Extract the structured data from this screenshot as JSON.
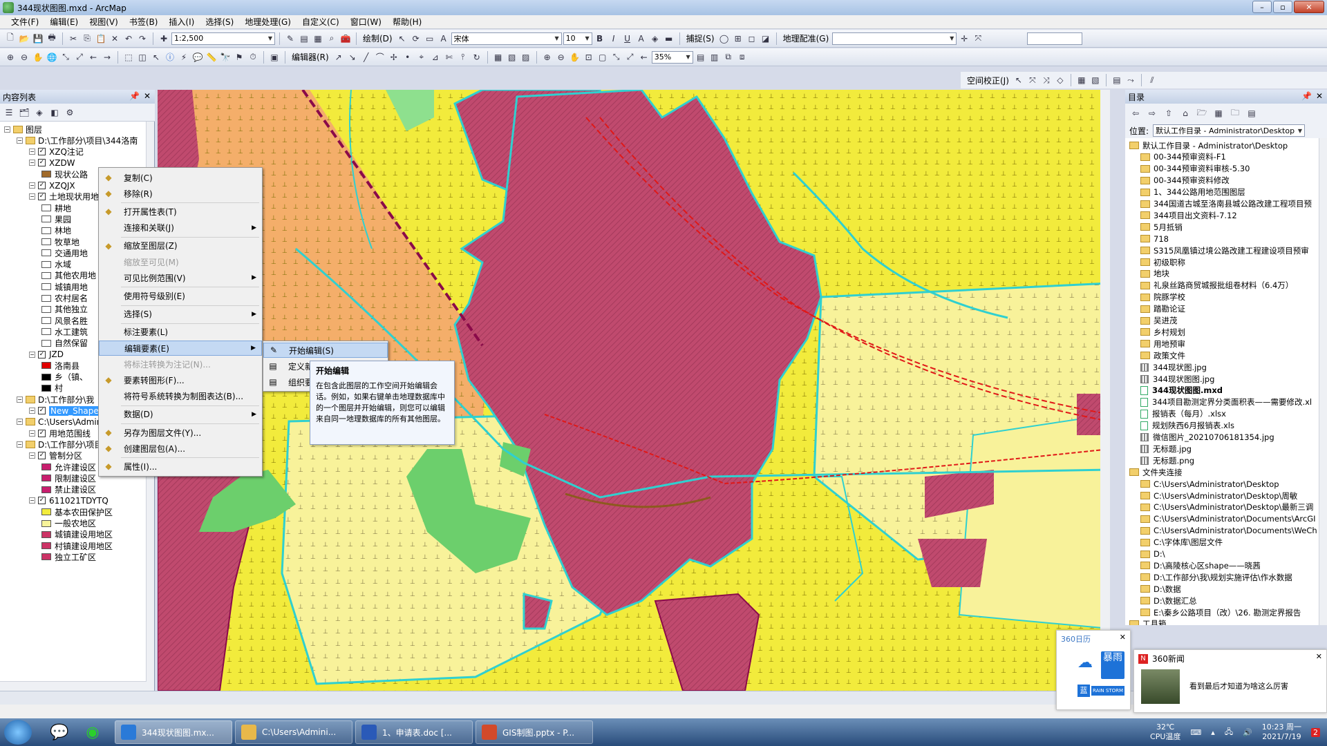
{
  "window": {
    "title": "344现状图图.mxd - ArcMap"
  },
  "menubar": [
    "文件(F)",
    "编辑(E)",
    "视图(V)",
    "书签(B)",
    "插入(I)",
    "选择(S)",
    "地理处理(G)",
    "自定义(C)",
    "窗口(W)",
    "帮助(H)"
  ],
  "toolbar1": {
    "scale": "1:2,500",
    "draw_label": "绘制(D)",
    "font": "宋体",
    "font_size": "10",
    "snap_label": "捕捉(S)",
    "georef_label": "地理配准(G)"
  },
  "toolbar2": {
    "editor_label": "编辑器(R)",
    "zoom_pct": "35%"
  },
  "toolbar3": {
    "spatial_adjust": "空间校正(J)"
  },
  "toc": {
    "title": "内容列表",
    "nodes": [
      {
        "label": "图层",
        "depth": 0,
        "type": "group"
      },
      {
        "label": "D:\\工作部分\\项目\\344洛南",
        "depth": 1,
        "type": "folder"
      },
      {
        "label": "XZQ注记",
        "depth": 2,
        "type": "layer"
      },
      {
        "label": "XZDW",
        "depth": 2,
        "type": "layer"
      },
      {
        "label": "现状公路",
        "depth": 3,
        "type": "legend",
        "color": "#a06a2a"
      },
      {
        "label": "XZQJX",
        "depth": 2,
        "type": "layer"
      },
      {
        "label": "土地现状用地",
        "depth": 2,
        "type": "layer"
      },
      {
        "label": "耕地",
        "depth": 3,
        "type": "legend",
        "color": "#ffffff"
      },
      {
        "label": "果园",
        "depth": 3,
        "type": "legend",
        "color": "#ffffff"
      },
      {
        "label": "林地",
        "depth": 3,
        "type": "legend",
        "color": "#ffffff"
      },
      {
        "label": "牧草地",
        "depth": 3,
        "type": "legend",
        "color": "#ffffff"
      },
      {
        "label": "交通用地",
        "depth": 3,
        "type": "legend",
        "color": "#ffffff"
      },
      {
        "label": "水域",
        "depth": 3,
        "type": "legend",
        "color": "#ffffff"
      },
      {
        "label": "其他农用地",
        "depth": 3,
        "type": "legend",
        "color": "#ffffff"
      },
      {
        "label": "城镇用地",
        "depth": 3,
        "type": "legend",
        "color": "#ffffff"
      },
      {
        "label": "农村居名",
        "depth": 3,
        "type": "legend",
        "color": "#ffffff"
      },
      {
        "label": "其他独立",
        "depth": 3,
        "type": "legend",
        "color": "#ffffff"
      },
      {
        "label": "风景名胜",
        "depth": 3,
        "type": "legend",
        "color": "#ffffff"
      },
      {
        "label": "水工建筑",
        "depth": 3,
        "type": "legend",
        "color": "#ffffff"
      },
      {
        "label": "自然保留",
        "depth": 3,
        "type": "legend",
        "color": "#ffffff"
      },
      {
        "label": "JZD",
        "depth": 2,
        "type": "layer"
      },
      {
        "label": "洛南县",
        "depth": 3,
        "type": "legend",
        "color": "#e00000"
      },
      {
        "label": "乡（镇、",
        "depth": 3,
        "type": "legend",
        "color": "#000000"
      },
      {
        "label": "村",
        "depth": 3,
        "type": "legend",
        "color": "#000000"
      },
      {
        "label": "D:\\工作部分\\我",
        "depth": 1,
        "type": "folder"
      },
      {
        "label": "New_Shapefile",
        "depth": 2,
        "type": "layer",
        "selected": true
      },
      {
        "label": "C:\\Users\\Administrator\\",
        "depth": 1,
        "type": "folder"
      },
      {
        "label": "用地范围线",
        "depth": 2,
        "type": "layer"
      },
      {
        "label": "D:\\工作部分\\项目\\344洛南",
        "depth": 1,
        "type": "folder"
      },
      {
        "label": "管制分区",
        "depth": 2,
        "type": "layer"
      },
      {
        "label": "允许建设区",
        "depth": 3,
        "type": "legend",
        "color": "#c81e6e"
      },
      {
        "label": "限制建设区",
        "depth": 3,
        "type": "legend",
        "color": "#c81e6e"
      },
      {
        "label": "禁止建设区",
        "depth": 3,
        "type": "legend",
        "color": "#c81e6e"
      },
      {
        "label": "611021TDYTQ",
        "depth": 2,
        "type": "layer"
      },
      {
        "label": "基本农田保护区",
        "depth": 3,
        "type": "legend",
        "color": "#f2ec3c"
      },
      {
        "label": "一般农地区",
        "depth": 3,
        "type": "legend",
        "color": "#f7f39a"
      },
      {
        "label": "城镇建设用地区",
        "depth": 3,
        "type": "legend",
        "color": "#cc3366"
      },
      {
        "label": "村镇建设用地区",
        "depth": 3,
        "type": "legend",
        "color": "#cc3366"
      },
      {
        "label": "独立工矿区",
        "depth": 3,
        "type": "legend",
        "color": "#cc3366"
      }
    ]
  },
  "context_menu": {
    "items": [
      {
        "label": "复制(C)",
        "icon": "copy-icon"
      },
      {
        "label": "移除(R)",
        "icon": "remove-icon"
      },
      {
        "sep": true
      },
      {
        "label": "打开属性表(T)",
        "icon": "table-icon"
      },
      {
        "label": "连接和关联(J)",
        "submenu": true
      },
      {
        "sep": true
      },
      {
        "label": "缩放至图层(Z)",
        "icon": "zoom-layer-icon"
      },
      {
        "label": "缩放至可见(M)",
        "disabled": true
      },
      {
        "label": "可见比例范围(V)",
        "submenu": true
      },
      {
        "sep": true
      },
      {
        "label": "使用符号级别(E)"
      },
      {
        "sep": true
      },
      {
        "label": "选择(S)",
        "submenu": true
      },
      {
        "sep": true
      },
      {
        "label": "标注要素(L)"
      },
      {
        "label": "编辑要素(E)",
        "submenu": true,
        "highlight": true
      },
      {
        "label": "将标注转换为注记(N)...",
        "disabled": true
      },
      {
        "label": "要素转图形(F)...",
        "icon": "feature-graphic-icon"
      },
      {
        "label": "将符号系统转换为制图表达(B)..."
      },
      {
        "sep": true
      },
      {
        "label": "数据(D)",
        "submenu": true
      },
      {
        "sep": true
      },
      {
        "label": "另存为图层文件(Y)...",
        "icon": "layer-file-icon"
      },
      {
        "label": "创建图层包(A)...",
        "icon": "package-icon"
      },
      {
        "sep": true
      },
      {
        "label": "属性(I)...",
        "icon": "properties-icon"
      }
    ]
  },
  "submenu": {
    "items": [
      "开始编辑(S)",
      "定义新",
      "组织要"
    ]
  },
  "tooltip": {
    "title": "开始编辑",
    "body": "在包含此图层的工作空间开始编辑会话。例如，如果右键单击地理数据库中的一个图层并开始编辑，则您可以编辑来自同一地理数据库的所有其他图层。"
  },
  "catalog": {
    "title": "目录",
    "location_label": "位置:",
    "location": "默认工作目录 - Administrator\\Desktop",
    "items": [
      {
        "label": "默认工作目录 - Administrator\\Desktop",
        "type": "root"
      },
      {
        "label": "00-344预审资料-F1",
        "type": "folder"
      },
      {
        "label": "00-344预审资料审核-5.30",
        "type": "folder"
      },
      {
        "label": "00-344预审资料修改",
        "type": "folder"
      },
      {
        "label": "1、344公路用地范围图层",
        "type": "folder"
      },
      {
        "label": "344国道古城至洛南县城公路改建工程项目预",
        "type": "folder"
      },
      {
        "label": "344项目出文资料-7.12",
        "type": "folder"
      },
      {
        "label": "5月抵销",
        "type": "folder"
      },
      {
        "label": "718",
        "type": "folder"
      },
      {
        "label": "S315凤凰镇过境公路改建工程建设项目预审",
        "type": "folder"
      },
      {
        "label": "初级职称",
        "type": "folder"
      },
      {
        "label": "地块",
        "type": "folder"
      },
      {
        "label": "礼泉丝路商贸城报批组卷材料（6.4万）",
        "type": "folder"
      },
      {
        "label": "院豚学校",
        "type": "folder"
      },
      {
        "label": "踏勘论证",
        "type": "folder"
      },
      {
        "label": "吴进茂",
        "type": "folder"
      },
      {
        "label": "乡村规划",
        "type": "folder"
      },
      {
        "label": "用地预审",
        "type": "folder"
      },
      {
        "label": "政策文件",
        "type": "folder"
      },
      {
        "label": "344现状图.jpg",
        "type": "image"
      },
      {
        "label": "344现状图图.jpg",
        "type": "image"
      },
      {
        "label": "344现状图图.mxd",
        "type": "mxd"
      },
      {
        "label": "344项目勘测定界分类面积表——需要修改.xl",
        "type": "doc"
      },
      {
        "label": "报销表（每月）.xlsx",
        "type": "doc"
      },
      {
        "label": "规划陕西6月报销表.xls",
        "type": "doc"
      },
      {
        "label": "微信图片_20210706181354.jpg",
        "type": "image"
      },
      {
        "label": "无标题.jpg",
        "type": "image"
      },
      {
        "label": "无标题.png",
        "type": "image"
      },
      {
        "label": "文件夹连接",
        "type": "root"
      },
      {
        "label": "C:\\Users\\Administrator\\Desktop",
        "type": "folder"
      },
      {
        "label": "C:\\Users\\Administrator\\Desktop\\周敏",
        "type": "folder"
      },
      {
        "label": "C:\\Users\\Administrator\\Desktop\\最新三调",
        "type": "folder"
      },
      {
        "label": "C:\\Users\\Administrator\\Documents\\ArcGI",
        "type": "folder"
      },
      {
        "label": "C:\\Users\\Administrator\\Documents\\WeCh",
        "type": "folder"
      },
      {
        "label": "C:\\字体库\\图层文件",
        "type": "folder"
      },
      {
        "label": "D:\\",
        "type": "folder"
      },
      {
        "label": "D:\\高陵核心区shape——晓茜",
        "type": "folder"
      },
      {
        "label": "D:\\工作部分\\我\\规划实施评估\\作水数据",
        "type": "folder"
      },
      {
        "label": "D:\\数据",
        "type": "folder"
      },
      {
        "label": "D:\\数据汇总",
        "type": "folder"
      },
      {
        "label": "E:\\秦乡公路项目（改）\\26. 勘测定界报告",
        "type": "folder"
      },
      {
        "label": "工具箱",
        "type": "root"
      }
    ]
  },
  "popup_calendar": {
    "title": "360日历",
    "icon_text": "暴雨",
    "badge": "RAIN STORM",
    "badge_short": "蓝"
  },
  "popup_news": {
    "title": "360新闻",
    "headline": "看到最后才知道为啥这么厉害"
  },
  "taskbar": {
    "tasks": [
      "344现状图图.mx...",
      "C:\\Users\\Admini...",
      "1、申请表.doc [...",
      "GIS制图.pptx - P..."
    ],
    "temp": "32℃",
    "temp_label": "CPU温度",
    "time": "10:23 周一",
    "date": "2021/7/19"
  }
}
